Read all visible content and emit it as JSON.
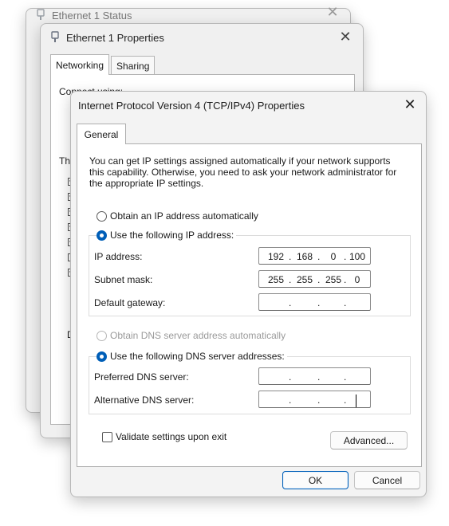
{
  "bg_window": {
    "title": "Ethernet 1 Status"
  },
  "properties_window": {
    "title": "Ethernet 1 Properties",
    "tabs": [
      "Networking",
      "Sharing"
    ],
    "fragments": {
      "connect_using": "Connect using:",
      "this_connection": "Th",
      "d": "D"
    }
  },
  "dialog": {
    "title": "Internet Protocol Version 4 (TCP/IPv4) Properties",
    "tab": "General",
    "intro": "You can get IP settings assigned automatically if your network supports this capability. Otherwise, you need to ask your network administrator for the appropriate IP settings.",
    "ip_auto_label": "Obtain an IP address automatically",
    "ip_manual_label": "Use the following IP address:",
    "ip_address_label": "IP address:",
    "ip_address": [
      "192",
      "168",
      "0",
      "100"
    ],
    "subnet_label": "Subnet mask:",
    "subnet": [
      "255",
      "255",
      "255",
      "0"
    ],
    "gateway_label": "Default gateway:",
    "gateway": [
      "",
      "",
      "",
      ""
    ],
    "dns_auto_label": "Obtain DNS server address automatically",
    "dns_manual_label": "Use the following DNS server addresses:",
    "preferred_dns_label": "Preferred DNS server:",
    "preferred_dns": [
      "",
      "",
      "",
      ""
    ],
    "alternative_dns_label": "Alternative DNS server:",
    "alternative_dns": [
      "",
      "",
      "",
      ""
    ],
    "validate_label": "Validate settings upon exit",
    "advanced_label": "Advanced...",
    "ok_label": "OK",
    "cancel_label": "Cancel",
    "ip_mode": "manual",
    "dns_mode": "manual",
    "validate_checked": false
  },
  "colors": {
    "accent": "#005fb8",
    "dialog_bg": "#f3f3f3",
    "panel_bg": "#ffffff"
  },
  "icons": {
    "network": "network-adapter-icon",
    "close": "close-icon"
  }
}
